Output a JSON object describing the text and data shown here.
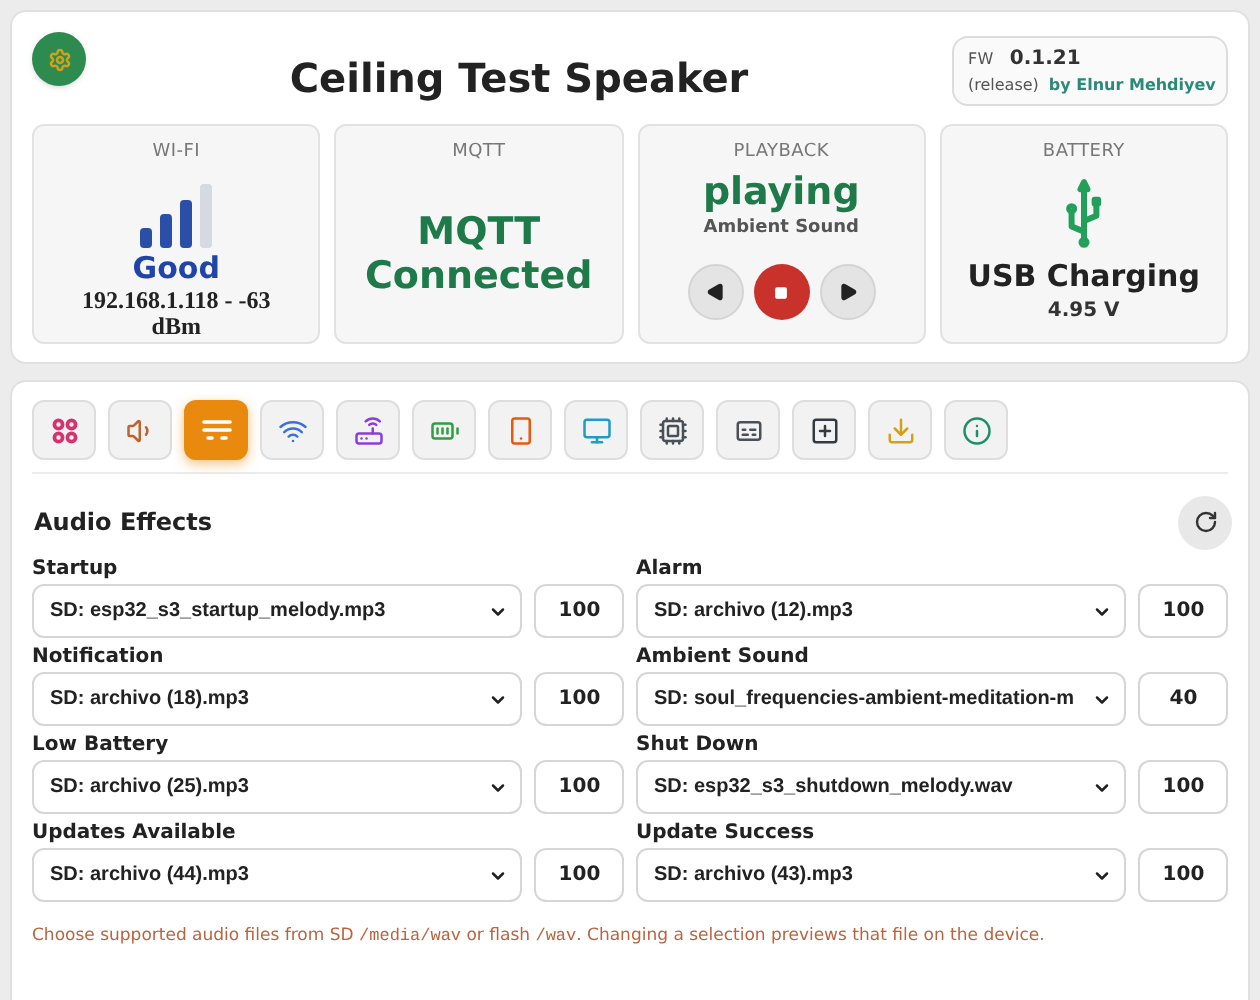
{
  "header": {
    "title": "Ceiling Test Speaker",
    "fw_label": "FW",
    "fw_version": "0.1.21",
    "fw_channel": "(release)",
    "author": "by Elnur Mehdiyev"
  },
  "cards": [
    {
      "kind": "wifi",
      "label": "WI-FI",
      "quality": "Good",
      "detail": "192.168.1.118 - -63 dBm"
    },
    {
      "kind": "mqtt",
      "label": "MQTT",
      "status": "MQTT Connected"
    },
    {
      "kind": "playback",
      "label": "PLAYBACK",
      "status": "playing",
      "track": "Ambient Sound"
    },
    {
      "kind": "battery",
      "label": "BATTERY",
      "status": "USB Charging",
      "voltage": "4.95 V"
    }
  ],
  "tabs": [
    {
      "kind": "grid",
      "color": "#d6336c",
      "selected": false
    },
    {
      "kind": "speaker",
      "color": "#c0622f",
      "selected": false
    },
    {
      "kind": "lines",
      "color": "#ffffff",
      "selected": true
    },
    {
      "kind": "wifi",
      "color": "#3b6fe0",
      "selected": false
    },
    {
      "kind": "router",
      "color": "#8b3fd9",
      "selected": false
    },
    {
      "kind": "battery",
      "color": "#2f9e44",
      "selected": false
    },
    {
      "kind": "phone",
      "color": "#e8590c",
      "selected": false
    },
    {
      "kind": "monitor",
      "color": "#1c9cc7",
      "selected": false
    },
    {
      "kind": "chip",
      "color": "#495057",
      "selected": false
    },
    {
      "kind": "card",
      "color": "#495057",
      "selected": false
    },
    {
      "kind": "plus",
      "color": "#343a40",
      "selected": false
    },
    {
      "kind": "download",
      "color": "#d4a017",
      "selected": false
    },
    {
      "kind": "info",
      "color": "#1f8f6a",
      "selected": false
    }
  ],
  "section": {
    "title": "Audio Effects",
    "effects": [
      {
        "label": "Startup",
        "file": "SD: esp32_s3_startup_melody.mp3",
        "volume": "100"
      },
      {
        "label": "Alarm",
        "file": "SD: archivo (12).mp3",
        "volume": "100"
      },
      {
        "label": "Notification",
        "file": "SD: archivo (18).mp3",
        "volume": "100"
      },
      {
        "label": "Ambient Sound",
        "file": "SD: soul_frequencies-ambient-meditation-m",
        "volume": "40"
      },
      {
        "label": "Low Battery",
        "file": "SD: archivo (25).mp3",
        "volume": "100"
      },
      {
        "label": "Shut Down",
        "file": "SD: esp32_s3_shutdown_melody.wav",
        "volume": "100"
      },
      {
        "label": "Updates Available",
        "file": "SD: archivo (44).mp3",
        "volume": "100"
      },
      {
        "label": "Update Success",
        "file": "SD: archivo (43).mp3",
        "volume": "100"
      }
    ],
    "note": [
      {
        "kind": "text",
        "text": "Choose supported audio files from SD "
      },
      {
        "kind": "code",
        "text": "/media/wav"
      },
      {
        "kind": "text",
        "text": " or flash "
      },
      {
        "kind": "code",
        "text": "/wav"
      },
      {
        "kind": "text",
        "text": ". Changing a selection previews that file on the device."
      }
    ]
  }
}
